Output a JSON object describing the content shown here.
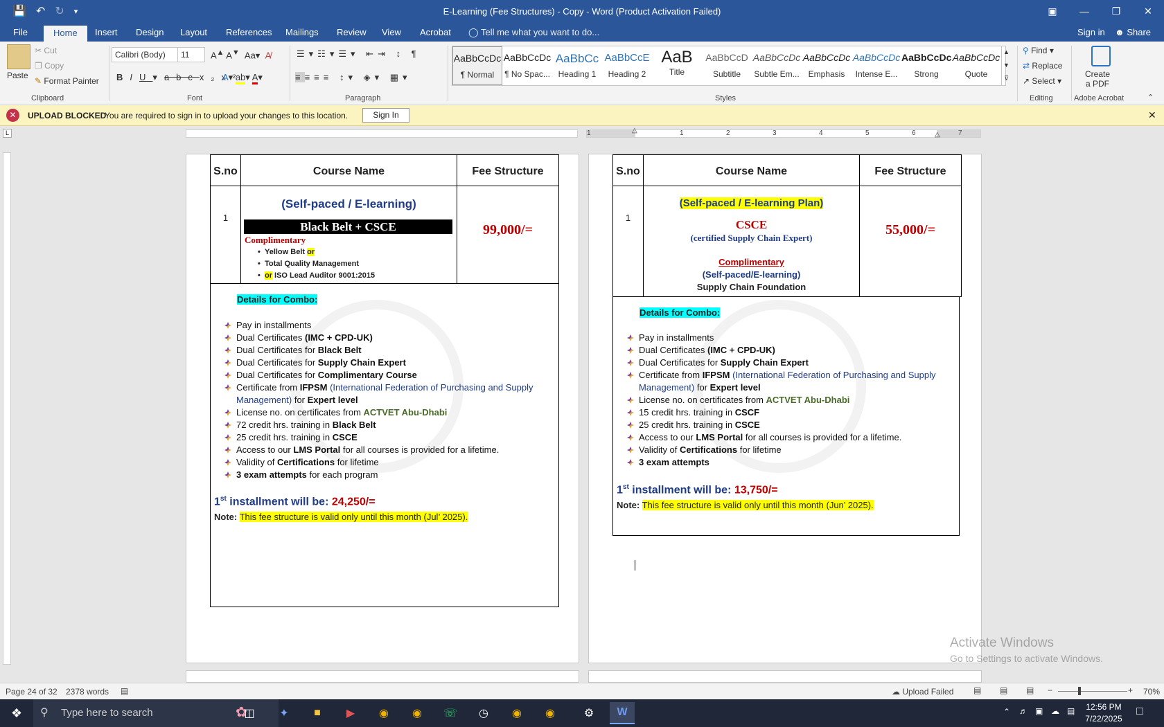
{
  "window": {
    "title": "E-Learning (Fee Structures) - Copy - Word (Product Activation Failed)"
  },
  "qat": {
    "save": "save-icon",
    "undo": "undo-icon",
    "redo": "redo-icon",
    "customize": "customize-icon"
  },
  "tabs": [
    "File",
    "Home",
    "Insert",
    "Design",
    "Layout",
    "References",
    "Mailings",
    "Review",
    "View",
    "Acrobat"
  ],
  "tell_me": "Tell me what you want to do...",
  "signin": "Sign in",
  "share": "Share",
  "clipboard": {
    "paste": "Paste",
    "cut": "Cut",
    "copy": "Copy",
    "format_painter": "Format Painter",
    "label": "Clipboard"
  },
  "font": {
    "name": "Calibri (Body)",
    "size": "11",
    "label": "Font"
  },
  "paragraph": {
    "label": "Paragraph"
  },
  "styles": {
    "label": "Styles",
    "items": [
      {
        "preview": "AaBbCcDc",
        "name": "¶ Normal"
      },
      {
        "preview": "AaBbCcDc",
        "name": "¶ No Spac..."
      },
      {
        "preview": "AaBbCc",
        "name": "Heading 1"
      },
      {
        "preview": "AaBbCcE",
        "name": "Heading 2"
      },
      {
        "preview": "AaB",
        "name": "Title"
      },
      {
        "preview": "AaBbCcD",
        "name": "Subtitle"
      },
      {
        "preview": "AaBbCcDc",
        "name": "Subtle Em..."
      },
      {
        "preview": "AaBbCcDc",
        "name": "Emphasis"
      },
      {
        "preview": "AaBbCcDc",
        "name": "Intense E..."
      },
      {
        "preview": "AaBbCcDc",
        "name": "Strong"
      },
      {
        "preview": "AaBbCcDc",
        "name": "Quote"
      }
    ]
  },
  "editing": {
    "find": "Find",
    "replace": "Replace",
    "select": "Select",
    "label": "Editing"
  },
  "acrobat": {
    "create": "Create",
    "pdf": "a PDF",
    "label": "Adobe Acrobat"
  },
  "notice": {
    "title": "UPLOAD BLOCKED",
    "message": "You are required to sign in to upload your changes to this location.",
    "button": "Sign In"
  },
  "table_header": {
    "sno": "S.no",
    "course": "Course Name",
    "fee": "Fee Structure"
  },
  "left": {
    "sno": "1",
    "heading": "(Self-paced / E-learning)",
    "banner": "Black Belt + CSCE",
    "complimentary": "Complimentary",
    "comp_items": [
      "Yellow Belt ",
      "or",
      "Total Quality Management",
      "or",
      " ISO Lead Auditor 9001:2015"
    ],
    "fee": "99,000/=",
    "details": "Details for Combo:",
    "bullets": [
      [
        "Pay in installments",
        "",
        ""
      ],
      [
        "Dual Certificates ",
        "(IMC + CPD-UK)",
        ""
      ],
      [
        "Dual Certificates for ",
        "Black Belt",
        ""
      ],
      [
        "Dual Certificates for ",
        "Supply Chain Expert",
        ""
      ],
      [
        "Dual Certificates for ",
        "Complimentary Course",
        ""
      ]
    ],
    "ifpsm": [
      "Certificate from ",
      "IFPSM",
      " (International Federation of Purchasing and Supply Management)",
      " for ",
      "Expert level"
    ],
    "license": [
      "License no. on certificates from ",
      "ACTVET Abu-Dhabi"
    ],
    "bullets2": [
      [
        "72 credit hrs. training in ",
        "Black Belt",
        ""
      ],
      [
        "25 credit hrs. training in ",
        "CSCE",
        ""
      ],
      [
        "Access to our ",
        "LMS Portal",
        " for all courses is provided for a lifetime."
      ],
      [
        "Validity of ",
        "Certifications",
        " for lifetime"
      ],
      [
        "",
        "3 exam attempts",
        " for each program"
      ]
    ],
    "inst_pre": "1",
    "inst_sup": "st",
    "inst_text": " installment will be: ",
    "inst_amount": "24,250/=",
    "note_label": "Note:",
    "note": "This fee structure is valid only until this month (Jul’ 2025)."
  },
  "right": {
    "sno": "1",
    "heading": "(Self-paced / E-learning Plan)",
    "course": "CSCE",
    "course_sub": "(certified Supply Chain Expert)",
    "complimentary": "Complimentary",
    "comp_sub": "(Self-paced/E-learning)",
    "comp_name": "Supply Chain Foundation",
    "fee": "55,000/=",
    "details": "Details for Combo:",
    "bullets": [
      [
        "Pay in installments",
        "",
        ""
      ],
      [
        "Dual Certificates ",
        "(IMC + CPD-UK)",
        ""
      ],
      [
        "Dual Certificates for ",
        "Supply Chain Expert",
        ""
      ]
    ],
    "ifpsm": [
      "Certificate from ",
      "IFPSM",
      " (International Federation of Purchasing and Supply Management)",
      " for ",
      "Expert level"
    ],
    "license": [
      "License no. on certificates from ",
      "ACTVET Abu-Dhabi"
    ],
    "bullets2": [
      [
        "15 credit hrs. training in ",
        "CSCF",
        ""
      ],
      [
        "25 credit hrs. training in ",
        "CSCE",
        ""
      ],
      [
        "Access to our ",
        "LMS Portal",
        " for all courses is provided for a lifetime."
      ],
      [
        "Validity of ",
        "Certifications",
        " for lifetime"
      ],
      [
        "",
        "3 exam attempts",
        ""
      ]
    ],
    "inst_pre": "1",
    "inst_sup": "st",
    "inst_text": " installment will be: ",
    "inst_amount": "13,750/=",
    "note_label": "Note:",
    "note": "This fee structure is valid only until this month (Jun’ 2025)."
  },
  "watermark": {
    "title": "Activate Windows",
    "sub": "Go to Settings to activate Windows."
  },
  "status": {
    "page": "Page 24 of 32",
    "words": "2378 words",
    "upload": "Upload Failed",
    "zoom": "70%"
  },
  "taskbar": {
    "search": "Type here to search",
    "time": "12:56 PM",
    "date": "7/22/2025"
  },
  "ruler_numbers": [
    "1",
    "1",
    "2",
    "3",
    "4",
    "5",
    "6",
    "7"
  ]
}
